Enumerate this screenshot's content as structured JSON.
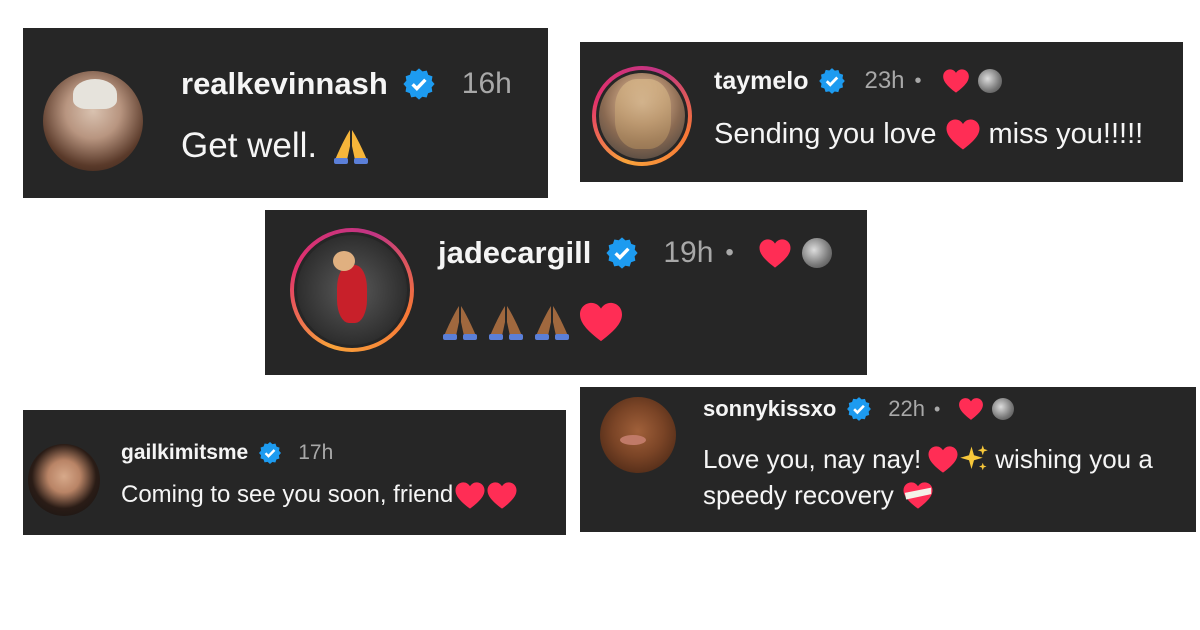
{
  "comments": [
    {
      "username": "realkevinnash",
      "time": "16h",
      "text": "Get well.",
      "emojis": [
        "folded-hands"
      ]
    },
    {
      "username": "taymelo",
      "time": "23h",
      "separator": "•",
      "text_before": "Sending you love",
      "text_after": "miss you!!!!!",
      "emojis": [
        "heart"
      ]
    },
    {
      "username": "jadecargill",
      "time": "19h",
      "separator": "•",
      "emojis": [
        "folded-hands",
        "folded-hands",
        "folded-hands",
        "heart"
      ]
    },
    {
      "username": "gailkimitsme",
      "time": "17h",
      "text": "Coming to see you soon, friend",
      "emojis": [
        "heart",
        "heart"
      ]
    },
    {
      "username": "sonnykissxo",
      "time": "22h",
      "separator": "•",
      "text_line1_before": "Love you, nay nay!",
      "text_line1_after": "wishing you a",
      "text_line2": "speedy recovery",
      "emojis": [
        "heart",
        "sparkles",
        "bandaged-heart"
      ]
    }
  ],
  "colors": {
    "card": "#262626",
    "verified": "#1d9bf0",
    "heart": "#ff2d55",
    "text": "#f5f5f5",
    "muted": "#a8a8a8"
  }
}
